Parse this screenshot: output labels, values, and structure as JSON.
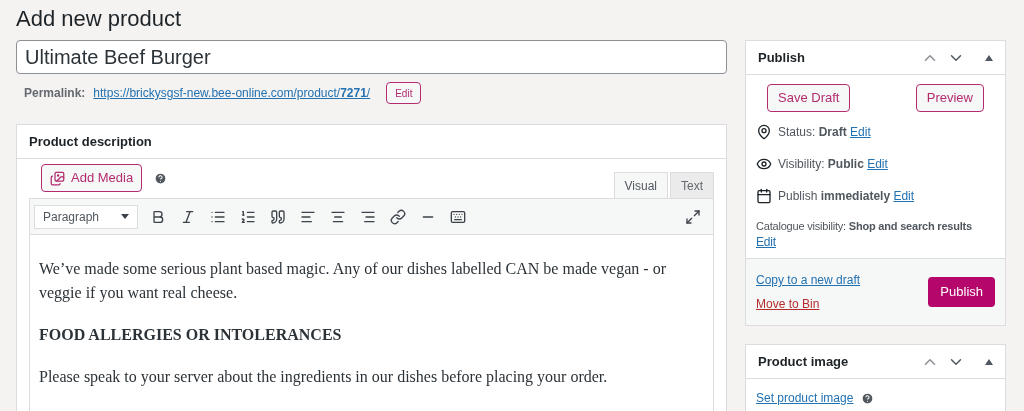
{
  "page_title": "Add new product",
  "title_field": {
    "value": "Ultimate Beef Burger"
  },
  "permalink": {
    "label": "Permalink:",
    "url": "https://brickysgsf-new.bee-online.com/product/**7271**/",
    "edit": "Edit"
  },
  "description": {
    "title": "Product description",
    "add_media": "Add Media",
    "tabs": [
      {
        "label": "Visual",
        "selected": true
      },
      {
        "label": "Text",
        "selected": false
      }
    ],
    "format": "Paragraph",
    "paragraphs": [
      {
        "kind": "text",
        "text": "We’ve made some serious plant based magic. Any of our dishes labelled CAN be made vegan - or veggie if you want real cheese."
      },
      {
        "kind": "heading",
        "text": "FOOD ALLERGIES OR INTOLERANCES"
      },
      {
        "kind": "text",
        "text": "Please speak to your server about the ingredients in our dishes before placing your order."
      }
    ]
  },
  "publish": {
    "title": "Publish",
    "save_draft": "Save Draft",
    "preview": "Preview",
    "rows": [
      {
        "kind": "status",
        "text": "Status: **Draft**",
        "edit": "Edit"
      },
      {
        "kind": "visibility",
        "text": "Visibility: **Public**",
        "edit": "Edit"
      },
      {
        "kind": "schedule",
        "text": "Publish **immediately**",
        "edit": "Edit"
      },
      {
        "kind": "catalogue",
        "text": "Catalogue visibility: **Shop and search results**",
        "edit": "Edit"
      }
    ],
    "copy": "Copy to a new draft",
    "bin": "Move to Bin",
    "publish": "Publish"
  },
  "product_image": {
    "title": "Product image",
    "link": "Set product image"
  }
}
